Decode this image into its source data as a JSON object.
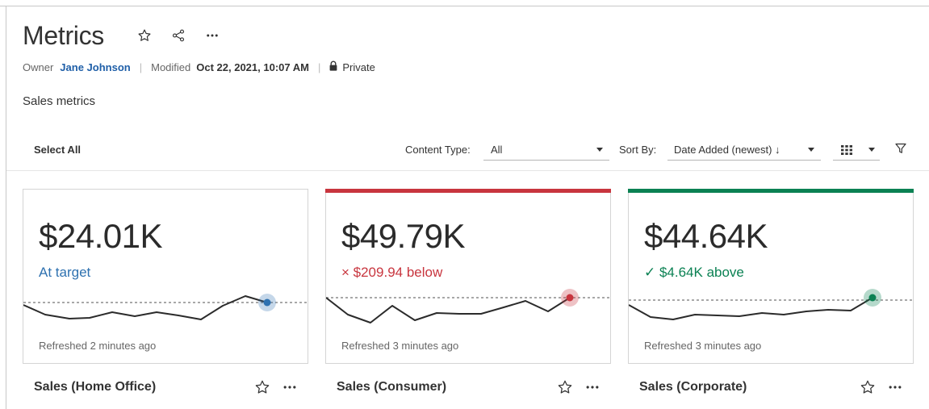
{
  "page": {
    "title": "Metrics",
    "owner_label": "Owner",
    "owner_name": "Jane Johnson",
    "modified_label": "Modified",
    "modified_date": "Oct 22, 2021, 10:07 AM",
    "privacy": "Private",
    "description": "Sales metrics"
  },
  "toolbar": {
    "select_all": "Select All",
    "content_type_label": "Content Type:",
    "content_type_value": "All",
    "sort_by_label": "Sort By:",
    "sort_by_value": "Date Added (newest) ↓"
  },
  "colors": {
    "red": "#c8353e",
    "green": "#0b8153",
    "blue": "#2e71b0",
    "link": "#1f5fa8"
  },
  "cards": [
    {
      "value": "$24.01K",
      "status": "At target",
      "status_kind": "neutral",
      "refreshed": "Refreshed 2 minutes ago",
      "name": "Sales (Home Office)"
    },
    {
      "value": "$49.79K",
      "status": "× $209.94 below",
      "status_kind": "bad",
      "refreshed": "Refreshed 3 minutes ago",
      "name": "Sales (Consumer)"
    },
    {
      "value": "$44.64K",
      "status": "✓ $4.64K above",
      "status_kind": "good",
      "refreshed": "Refreshed 3 minutes ago",
      "name": "Sales (Corporate)"
    }
  ]
}
